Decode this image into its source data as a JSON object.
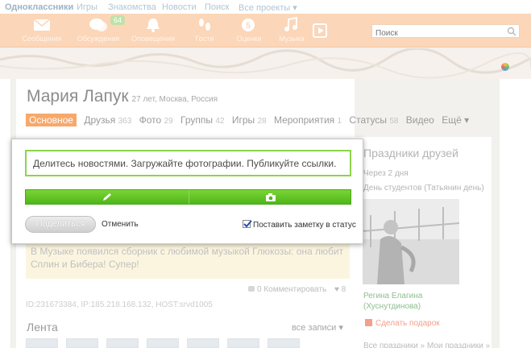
{
  "topbar": {
    "site": "Одноклассники",
    "links": [
      "Игры",
      "Знакомства",
      "Новости",
      "Поиск",
      "Все проекты ▾"
    ]
  },
  "toolbar": {
    "items": [
      {
        "label": "Сообщения",
        "icon": "envelope-icon"
      },
      {
        "label": "Обсуждения",
        "icon": "chat-bubbles-icon"
      },
      {
        "label": "Оповещения",
        "icon": "bell-icon"
      },
      {
        "label": "Гости",
        "icon": "footprints-icon"
      },
      {
        "label": "Оценки",
        "icon": "rating-icon"
      },
      {
        "label": "Музыка",
        "icon": "music-note-icon"
      }
    ],
    "discussions_badge": "64",
    "search_placeholder": "Поиск"
  },
  "profile": {
    "name": "Мария Лапук",
    "details": "27 лет, Москва, Россия",
    "tabs": [
      {
        "label": "Основное",
        "count": ""
      },
      {
        "label": "Друзья",
        "count": "363"
      },
      {
        "label": "Фото",
        "count": "29"
      },
      {
        "label": "Группы",
        "count": "42"
      },
      {
        "label": "Игры",
        "count": "28"
      },
      {
        "label": "Мероприятия",
        "count": "1"
      },
      {
        "label": "Статусы",
        "count": "58"
      },
      {
        "label": "Видео",
        "count": ""
      },
      {
        "label": "Ещё ▾",
        "count": ""
      }
    ]
  },
  "post_popup": {
    "input_placeholder": "Делитесь новостями. Загружайте фотографии. Публикуйте ссылки.",
    "share_button": "Поделиться",
    "cancel_link": "Отменить",
    "status_checkbox_label": "Поставить заметку в статус",
    "status_checkbox_checked": true
  },
  "status": {
    "text": "В Музыке появился сборник с любимой музыкой Глюкозы: она любит Сплин и Бибера! Супер!",
    "comments": "0 Комментировать",
    "likes": "8",
    "meta": "ID:231673384, IP:185.218.168.132, HOST:srvd1005"
  },
  "feed": {
    "title": "Лента",
    "all_link": "все записи ▾"
  },
  "holidays": {
    "title": "Праздники друзей",
    "when": "Через 2 дня",
    "event": "День студентов (Татьянин день)",
    "friend": "Регина Елагина (Хуснутдинова)",
    "gift_link": "Сделать подарок",
    "more": "Все праздники »   Мои праздники »"
  },
  "colors": {
    "accent_orange": "#f7a86b",
    "toolbar_bg": "#fbd6b8",
    "green_border": "#8bd54a",
    "green_bar": "#4fb61a"
  }
}
